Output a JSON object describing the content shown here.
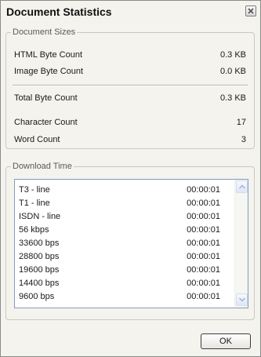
{
  "window": {
    "title": "Document Statistics",
    "close_icon": "close-icon"
  },
  "document_sizes": {
    "label": "Document Sizes",
    "rows": [
      {
        "label": "HTML Byte Count",
        "value": "0.3 KB"
      },
      {
        "label": "Image Byte Count",
        "value": "0.0 KB"
      },
      {
        "label": "Total Byte Count",
        "value": "0.3 KB"
      },
      {
        "label": "Character Count",
        "value": "17"
      },
      {
        "label": "Word Count",
        "value": "3"
      }
    ]
  },
  "download_time": {
    "label": "Download Time",
    "rows": [
      {
        "label": "T3 - line",
        "value": "00:00:01"
      },
      {
        "label": "T1 - line",
        "value": "00:00:01"
      },
      {
        "label": "ISDN - line",
        "value": "00:00:01"
      },
      {
        "label": "56 kbps",
        "value": "00:00:01"
      },
      {
        "label": "33600 bps",
        "value": "00:00:01"
      },
      {
        "label": "28800 bps",
        "value": "00:00:01"
      },
      {
        "label": "19600 bps",
        "value": "00:00:01"
      },
      {
        "label": "14400 bps",
        "value": "00:00:01"
      },
      {
        "label": "9600 bps",
        "value": "00:00:01"
      }
    ],
    "scrollbar_icons": [
      "scroll-up-arrow-icon",
      "scroll-down-arrow-icon"
    ]
  },
  "buttons": {
    "ok_label": "OK"
  }
}
